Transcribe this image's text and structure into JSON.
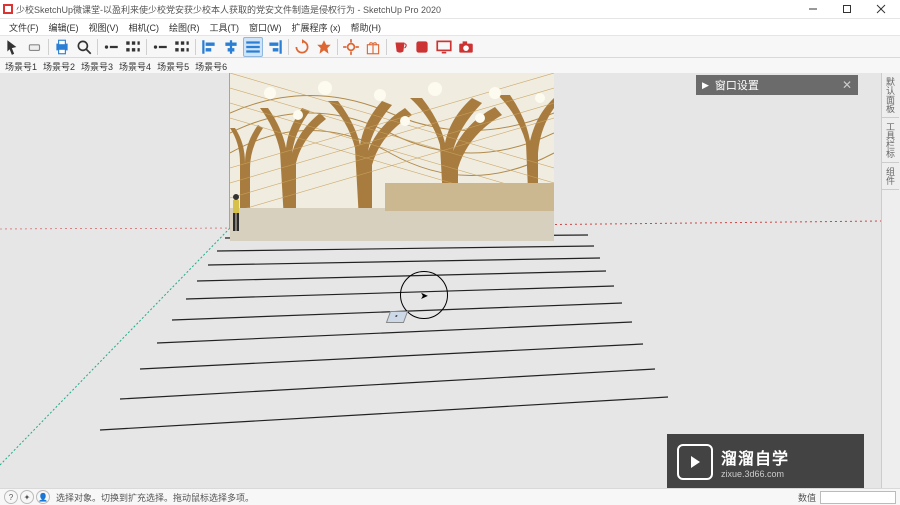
{
  "title": "少校SketchUp微课堂-以盈利来使少校党安获少校本人获取的党安文件制造是侵权行为 - SketchUp Pro 2020",
  "menu": [
    "文件(F)",
    "编辑(E)",
    "视图(V)",
    "相机(C)",
    "绘图(R)",
    "工具(T)",
    "窗口(W)",
    "扩展程序 (x)",
    "帮助(H)"
  ],
  "layer_labels": [
    "场景号1",
    "场景号2",
    "场景号3",
    "场景号4",
    "场景号5",
    "场景号6"
  ],
  "panel": {
    "title": "窗口设置"
  },
  "side_tabs": [
    "默认面板",
    "工具栏标",
    "组件"
  ],
  "status": {
    "hint": "选择对象。切换到扩充选择。拖动鼠标选择多项。",
    "right_label": "数值"
  },
  "watermark": {
    "cn": "溜溜自学",
    "url": "zixue.3d66.com"
  },
  "toolbar_icons": [
    {
      "name": "select-arrow-icon",
      "svg": "arrow",
      "color": "#333"
    },
    {
      "name": "eraser-icon",
      "svg": "eraser",
      "color": "#888"
    },
    {
      "name": "separator"
    },
    {
      "name": "print-icon",
      "svg": "printer",
      "color": "#2a7fd4"
    },
    {
      "name": "zoom-extent-icon",
      "svg": "zoomext",
      "color": "#333"
    },
    {
      "name": "separator"
    },
    {
      "name": "bullet-icon",
      "svg": "dot",
      "color": "#333"
    },
    {
      "name": "grid3-icon",
      "svg": "grid3",
      "color": "#333"
    },
    {
      "name": "separator"
    },
    {
      "name": "bullet2-icon",
      "svg": "dot",
      "color": "#333"
    },
    {
      "name": "grid3b-icon",
      "svg": "grid3",
      "color": "#333"
    },
    {
      "name": "separator"
    },
    {
      "name": "align-left-icon",
      "svg": "alignl",
      "color": "#2a7fd4"
    },
    {
      "name": "align-center-icon",
      "svg": "alignc",
      "color": "#2a7fd4"
    },
    {
      "name": "align-dist-icon",
      "svg": "alignd",
      "color": "#2a7fd4",
      "active": true
    },
    {
      "name": "align-right-icon",
      "svg": "alignr",
      "color": "#2a7fd4"
    },
    {
      "name": "separator"
    },
    {
      "name": "refresh-icon",
      "svg": "refresh",
      "color": "#d63"
    },
    {
      "name": "star-icon",
      "svg": "star",
      "color": "#d63"
    },
    {
      "name": "separator"
    },
    {
      "name": "gear-icon",
      "svg": "gear",
      "color": "#d63"
    },
    {
      "name": "gift-icon",
      "svg": "gift",
      "color": "#d63"
    },
    {
      "name": "separator"
    },
    {
      "name": "cup-icon",
      "svg": "cup",
      "color": "#c33"
    },
    {
      "name": "stop-icon",
      "svg": "stop",
      "color": "#c33"
    },
    {
      "name": "monitor-icon",
      "svg": "monitor",
      "color": "#c33"
    },
    {
      "name": "camera-icon",
      "svg": "camera",
      "color": "#c33"
    }
  ]
}
